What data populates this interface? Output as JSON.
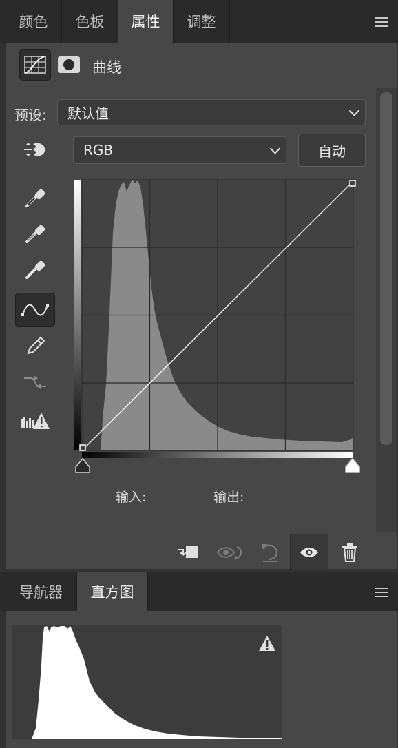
{
  "top_tabs": [
    {
      "label": "颜色",
      "active": false
    },
    {
      "label": "色板",
      "active": false
    },
    {
      "label": "属性",
      "active": true
    },
    {
      "label": "调整",
      "active": false
    }
  ],
  "properties": {
    "title": "曲线",
    "preset_label": "预设:",
    "preset_value": "默认值",
    "channel_value": "RGB",
    "auto_button": "自动",
    "input_label": "输入:",
    "output_label": "输出:",
    "tools": [
      "on-image-adjust-icon",
      "black-point-eyedropper-icon",
      "gray-point-eyedropper-icon",
      "white-point-eyedropper-icon",
      "curve-points-icon",
      "pencil-icon",
      "smooth-curve-icon",
      "clipping-warning-icon"
    ],
    "selected_tool": "curve-points-icon"
  },
  "footer_buttons": [
    "clip-to-layer-icon",
    "view-previous-state-icon",
    "reset-icon",
    "visibility-eye-icon",
    "delete-icon"
  ],
  "bottom_tabs": [
    {
      "label": "导航器",
      "active": false
    },
    {
      "label": "直方图",
      "active": true
    }
  ],
  "colors": {
    "panel_bg": "#474747",
    "tab_bar_bg": "#2a2a2a",
    "graph_bg": "#424242",
    "histogram_fill": "#8a8a8a"
  }
}
